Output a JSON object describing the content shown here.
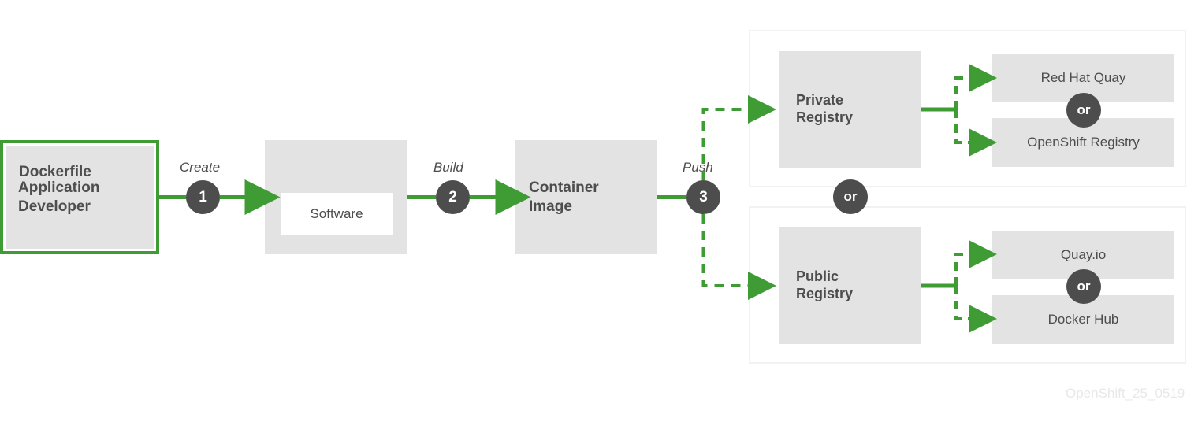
{
  "diagram": {
    "title_watermark": "OpenShift_25_0519",
    "accent_green": "#3f9c35",
    "node_gray": "#e3e3e3",
    "text_gray": "#4d4d4d",
    "frame_gray": "#f2f2f2"
  },
  "nodes": {
    "app_developer": "Application\nDeveloper",
    "dockerfile": "Dockerfile",
    "software": "Software",
    "container_image": "Container\nImage",
    "private_registry": "Private\nRegistry",
    "public_registry": "Public\nRegistry"
  },
  "options": {
    "private": [
      {
        "label": "Red Hat Quay"
      },
      {
        "label": "OpenShift Registry"
      }
    ],
    "public": [
      {
        "label": "Quay.io"
      },
      {
        "label": "Docker Hub"
      }
    ]
  },
  "steps": [
    {
      "number": "1",
      "action": "Create"
    },
    {
      "number": "2",
      "action": "Build"
    },
    {
      "number": "3",
      "action": "Push"
    }
  ],
  "or_badges": {
    "private": "or",
    "public": "or",
    "between_groups": "or"
  }
}
